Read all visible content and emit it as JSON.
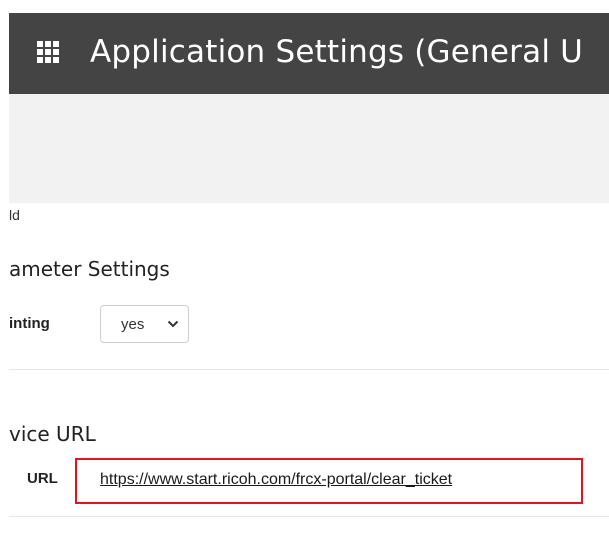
{
  "header": {
    "title": "Application Settings (General U",
    "icon": "apps-grid-icon",
    "background": "#444444",
    "text_color": "#ffffff"
  },
  "content": {
    "field_fragment": "ld",
    "parameter_section": {
      "heading": "ameter Settings",
      "printing_label": "inting",
      "printing_value": "yes"
    },
    "service_section": {
      "heading": "vice URL",
      "url_label": "URL",
      "url_value": "https://www.start.ricoh.com/frcx-portal/clear_ticket",
      "highlight_color": "#e0161d"
    }
  }
}
